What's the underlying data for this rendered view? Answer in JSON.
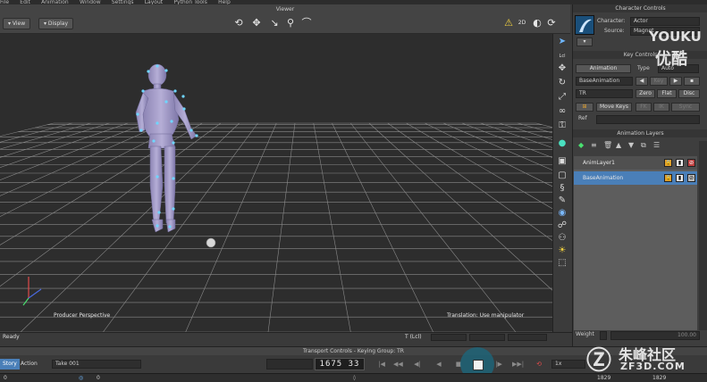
{
  "menu": [
    "File",
    "Edit",
    "Animation",
    "Window",
    "Settings",
    "Layout",
    "Python Tools",
    "Help"
  ],
  "viewer": {
    "title": "Viewer",
    "view_menu": "View",
    "display_menu": "Display",
    "view_label": "Producer Perspective",
    "manipulator_info": "Translation: Use manipulator",
    "mode_label": "2D"
  },
  "character_controls": {
    "title": "Character Controls",
    "character_label": "Character:",
    "character_value": "Actor",
    "source_label": "Source:",
    "source_value": "Magnet",
    "key_controls_title": "Key Controls",
    "animation_button": "Animation",
    "type_label": "Type",
    "type_value": "Auto",
    "base_animation": "BaseAnimation",
    "key_button": "Key",
    "tr_value": "TR",
    "zero_button": "Zero",
    "flat_button": "Flat",
    "disc_button": "Disc",
    "move_keys_button": "Move Keys",
    "fk_button": "FK",
    "ik_button": "IK",
    "sync_button": "Sync",
    "ref_label": "Ref",
    "lcl_label": "Lcl"
  },
  "animation_layers": {
    "title": "Animation Layers",
    "layers": [
      {
        "name": "AnimLayer1",
        "selected": false
      },
      {
        "name": "BaseAnimation",
        "selected": true
      }
    ],
    "weight_label": "Weight",
    "weight_value": "100.00"
  },
  "status": {
    "text": "Ready",
    "coords_label": "T (Lcl)"
  },
  "transport": {
    "title": "Transport Controls  -  Keying Group: TR",
    "story_tab": "Story",
    "action_tab": "Action",
    "take": "Take 001",
    "timecode": "1675  33",
    "speed": "1x",
    "start_frame": "0",
    "start_frame2": "0",
    "end_frame": "1829",
    "end_frame2": "1829"
  },
  "watermarks": {
    "youku_latin": "YOUKU",
    "youku_cn": "优酷",
    "zf3d_cn": "朱峰社区",
    "zf3d_url": "ZF3D.COM"
  },
  "colors": {
    "selection_blue": "#4a7fb8",
    "viewport_bg": "#2d2d2d",
    "grid_line": "#7a7a7a",
    "character": "#a79fc9",
    "marker": "#6fd6ff"
  }
}
